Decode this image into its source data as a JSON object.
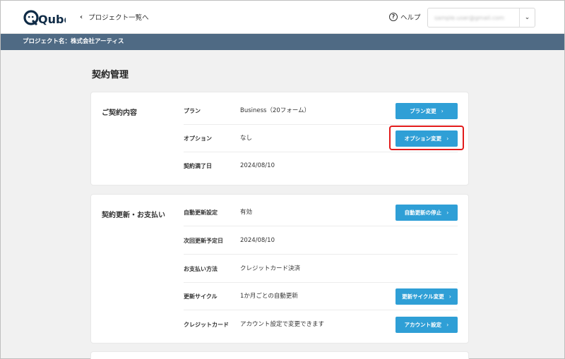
{
  "header": {
    "logo_text": "Qubo",
    "back_label": "プロジェクト一覧へ",
    "help_label": "ヘルプ",
    "account_email": "sample.user@gmail.com"
  },
  "project_bar": {
    "label": "プロジェクト名：株式会社アーティス"
  },
  "page_title": "契約管理",
  "contract": {
    "title": "ご契約内容",
    "rows": [
      {
        "label": "プラン",
        "value": "Business（20フォーム）",
        "button": "プラン変更"
      },
      {
        "label": "オプション",
        "value": "なし",
        "button": "オプション変更"
      },
      {
        "label": "契約満了日",
        "value": "2024/08/10"
      }
    ]
  },
  "renewal": {
    "title": "契約更新・お支払い",
    "rows": [
      {
        "label": "自動更新設定",
        "value": "有効",
        "button": "自動更新の停止"
      },
      {
        "label": "次回更新予定日",
        "value": "2024/08/10"
      },
      {
        "label": "お支払い方法",
        "value": "クレジットカード決済"
      },
      {
        "label": "更新サイクル",
        "value": "1か月ごとの自動更新",
        "button": "更新サイクル変更"
      },
      {
        "label": "クレジットカード",
        "value": "アカウント設定で変更できます",
        "button": "アカウント設定"
      }
    ]
  },
  "icons": {
    "back": "chevron-left-icon",
    "help": "help-circle-icon",
    "caret": "chevron-down-icon",
    "button": "chevron-right-icon"
  },
  "colors": {
    "accent": "#2f9fd6",
    "project_bar": "#4f6a84",
    "highlight": "#e21b1b",
    "logo": "#0f2b46"
  }
}
